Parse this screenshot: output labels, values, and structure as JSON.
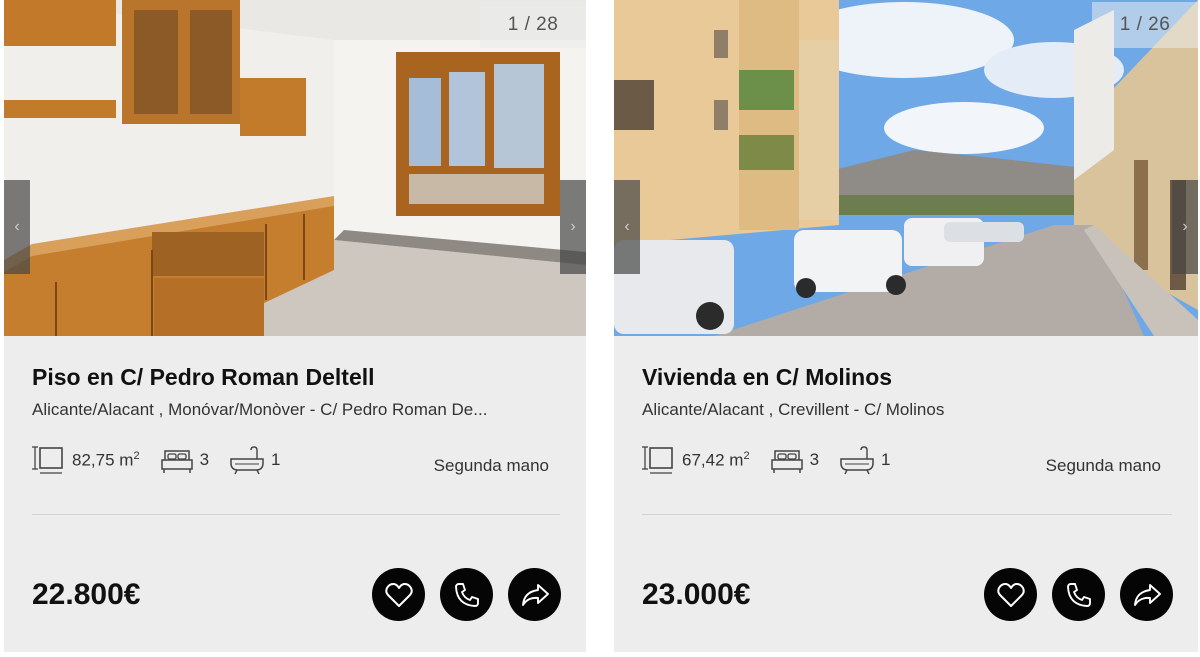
{
  "listings": [
    {
      "photo_counter": "1 / 28",
      "title": "Piso en C/ Pedro Roman Deltell",
      "location": "Alicante/Alacant , Monóvar/Monòver - C/ Pedro Roman De...",
      "area": "82,75 m",
      "area_unit_sup": "2",
      "bedrooms": "3",
      "bathrooms": "1",
      "condition": "Segunda mano",
      "price": "22.800€"
    },
    {
      "photo_counter": "1 / 26",
      "title": "Vivienda en C/ Molinos",
      "location": "Alicante/Alacant , Crevillent - C/ Molinos",
      "area": "67,42 m",
      "area_unit_sup": "2",
      "bedrooms": "3",
      "bathrooms": "1",
      "condition": "Segunda mano",
      "price": "23.000€"
    }
  ],
  "icons": {
    "prev": "chevron-left-icon",
    "next": "chevron-right-icon",
    "area": "area-icon",
    "bed": "bed-icon",
    "bath": "bathtub-icon",
    "favorite": "heart-icon",
    "call": "phone-icon",
    "share": "share-icon"
  },
  "colors": {
    "card_bg": "#ededee",
    "button_bg": "#050505",
    "text": "#111111"
  }
}
